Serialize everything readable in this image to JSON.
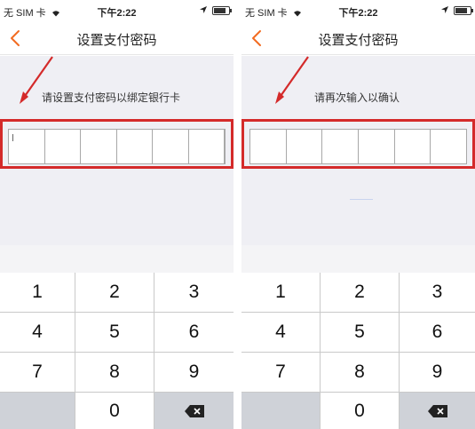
{
  "status_bar": {
    "carrier": "无 SIM 卡",
    "time": "下午2:22",
    "battery_level": 0.8,
    "icons": [
      "wifi-icon",
      "location-icon",
      "battery-icon"
    ]
  },
  "nav": {
    "title": "设置支付密码",
    "back_icon": "chevron-left-icon"
  },
  "left_screen": {
    "prompt": "请设置支付密码以绑定银行卡",
    "cell_count": 6
  },
  "right_screen": {
    "prompt": "请再次输入以确认",
    "cell_count": 6
  },
  "keypad": {
    "keys": [
      "1",
      "2",
      "3",
      "4",
      "5",
      "6",
      "7",
      "8",
      "9",
      "",
      "0",
      "delete-icon"
    ]
  },
  "colors": {
    "accent": "#f26b21",
    "highlight_frame": "#d42a2a",
    "arrow": "#d42a2a",
    "background": "#efeff4",
    "key_gray": "#cfd2d8"
  }
}
